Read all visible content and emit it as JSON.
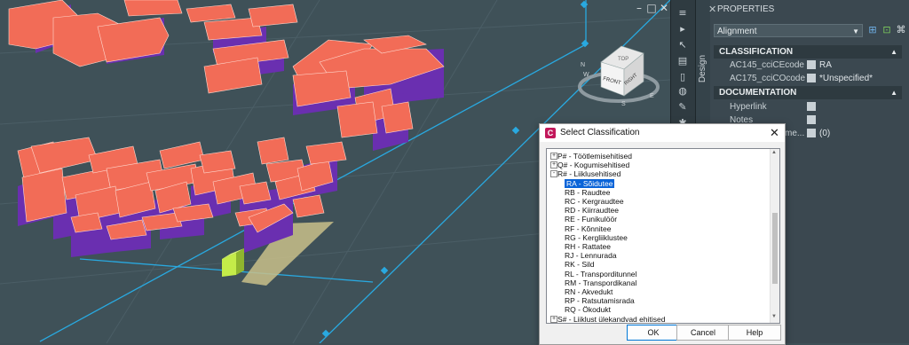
{
  "viewport": {
    "window_controls": [
      "–",
      "□",
      "✕"
    ],
    "viewcube": {
      "top_label": "TOP",
      "front_label": "FRONT",
      "right_label": "RIGHT",
      "compass": [
        "N",
        "W",
        "E",
        "S"
      ]
    },
    "colors": {
      "background": "#3f5158",
      "roof": "#f26c57",
      "side": "#6a2fb0",
      "highlight": "#c4ec49",
      "site": "#c9bf8a",
      "alignment": "#29a9e0"
    }
  },
  "design_tab": {
    "label": "Design"
  },
  "properties": {
    "title": "PROPERTIES",
    "selector": "Alignment",
    "sections": [
      {
        "name": "CLASSIFICATION",
        "rows": [
          {
            "key": "AC145_cciCEcode",
            "value": "RA"
          },
          {
            "key": "AC175_cciCOcode",
            "value": "*Unspecified*"
          }
        ]
      },
      {
        "name": "DOCUMENTATION",
        "rows": [
          {
            "key": "Hyperlink",
            "value": ""
          },
          {
            "key": "Notes",
            "value": ""
          },
          {
            "key": "me...",
            "value": "(0)"
          }
        ]
      }
    ]
  },
  "dialog": {
    "title": "Select Classification",
    "app_icon": "C",
    "items": [
      {
        "label": "P# - Töötlemisehitised",
        "level": 0,
        "toggle": "+"
      },
      {
        "label": "Q# - Kogumisehitised",
        "level": 0,
        "toggle": "+"
      },
      {
        "label": "R# - Liiklusehitised",
        "level": 0,
        "toggle": "−"
      },
      {
        "label": "RA - Sõidutee",
        "level": 1,
        "selected": true
      },
      {
        "label": "RB - Raudtee",
        "level": 1
      },
      {
        "label": "RC - Kergraudtee",
        "level": 1
      },
      {
        "label": "RD - Kiirraudtee",
        "level": 1
      },
      {
        "label": "RE - Funikulöör",
        "level": 1
      },
      {
        "label": "RF - Kõnnitee",
        "level": 1
      },
      {
        "label": "RG - Kergliiklustee",
        "level": 1
      },
      {
        "label": "RH - Rattatee",
        "level": 1
      },
      {
        "label": "RJ - Lennurada",
        "level": 1
      },
      {
        "label": "RK - Sild",
        "level": 1
      },
      {
        "label": "RL - Transporditunnel",
        "level": 1
      },
      {
        "label": "RM - Transpordikanal",
        "level": 1
      },
      {
        "label": "RN - Akvedukt",
        "level": 1
      },
      {
        "label": "RP - Ratsutamisrada",
        "level": 1
      },
      {
        "label": "RQ - Ökodukt",
        "level": 1
      },
      {
        "label": "S# - Liiklust ülekandvad ehitised",
        "level": 0,
        "toggle": "+"
      }
    ],
    "buttons": {
      "ok": "OK",
      "cancel": "Cancel",
      "help": "Help"
    }
  }
}
